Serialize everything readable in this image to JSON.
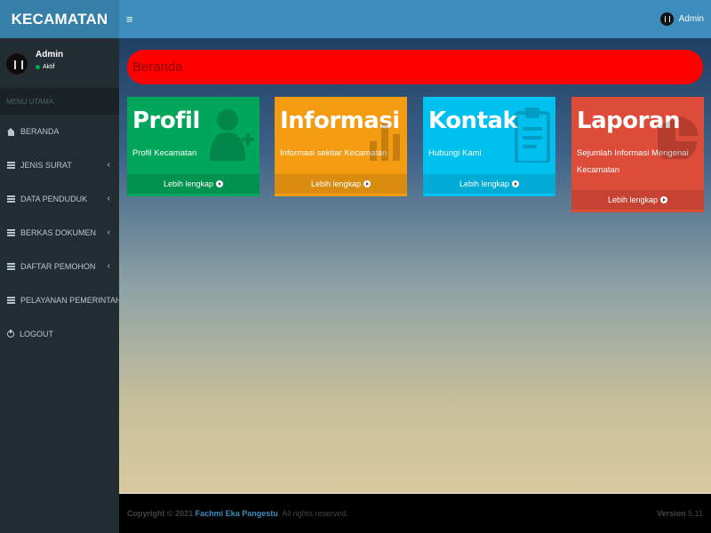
{
  "header": {
    "logo": "KECAMATAN",
    "toggle_icon": "≡",
    "user_name": "Admin"
  },
  "sidebar": {
    "user_name": "Admin",
    "user_status": "Aktif",
    "menu_header": "MENU UTAMA",
    "items": [
      {
        "label": "BERANDA",
        "icon": "home-icon"
      },
      {
        "label": "JENIS SURAT",
        "icon": "list-icon"
      },
      {
        "label": "DATA PENDUDUK",
        "icon": "list-icon"
      },
      {
        "label": "BERKAS DOKUMEN",
        "icon": "list-icon"
      },
      {
        "label": "DAFTAR PEMOHON",
        "icon": "list-icon"
      },
      {
        "label": "PELAYANAN PEMERINTAHAN",
        "icon": "list-icon"
      },
      {
        "label": "LOGOUT",
        "icon": "power-icon"
      }
    ],
    "chevron": "‹"
  },
  "main": {
    "page_title": "Beranda",
    "boxes": [
      {
        "title": "Profil",
        "desc": "Profil Kecamatan",
        "link": "Lebih lengkap",
        "color": "#00a65a",
        "icon": "user-plus-icon"
      },
      {
        "title": "Informasi",
        "desc": "Informasi sekitar Kecamatan",
        "link": "Lebih lengkap",
        "color": "#f39c12",
        "icon": "bar-chart-icon"
      },
      {
        "title": "Kontak",
        "desc": "Hubungi Kami",
        "link": "Lebih lengkap",
        "color": "#00c0ef",
        "icon": "clipboard-icon"
      },
      {
        "title": "Laporan",
        "desc": "Sejumlah Informasi Mengenai Kecamatan",
        "link": "Lebih lengkap",
        "color": "#dd4b39",
        "icon": "pie-chart-icon"
      }
    ]
  },
  "footer": {
    "copyright_prefix": "Copyright © 2021",
    "author": "Fachmi Eka Pangestu",
    "rights": ". All rights reserved.",
    "version_label": "Version",
    "version_number": "5.11"
  }
}
